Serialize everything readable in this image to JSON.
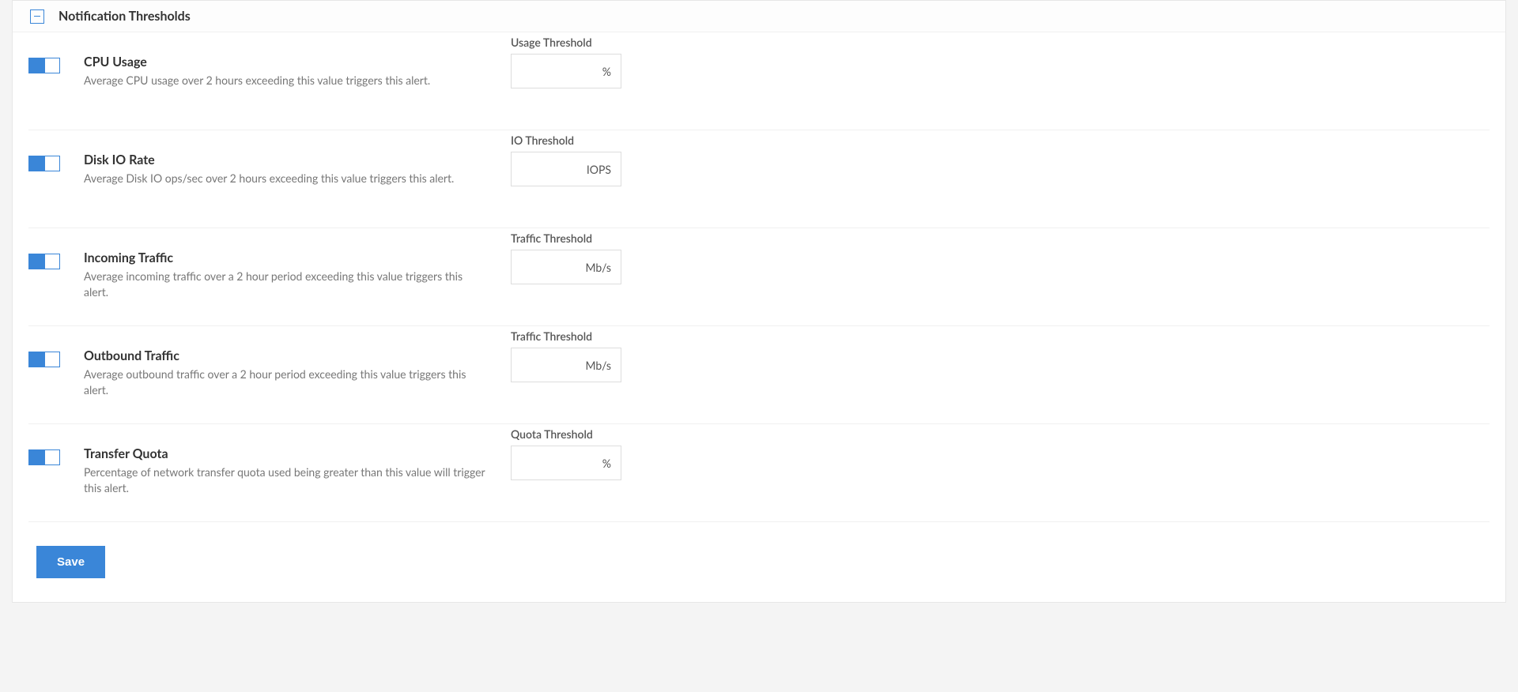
{
  "panel": {
    "title": "Notification Thresholds"
  },
  "rows": [
    {
      "title": "CPU Usage",
      "desc": "Average CPU usage over 2 hours exceeding this value triggers this alert.",
      "inputLabel": "Usage Threshold",
      "unit": "%",
      "value": ""
    },
    {
      "title": "Disk IO Rate",
      "desc": "Average Disk IO ops/sec over 2 hours exceeding this value triggers this alert.",
      "inputLabel": "IO Threshold",
      "unit": "IOPS",
      "value": ""
    },
    {
      "title": "Incoming Traffic",
      "desc": "Average incoming traffic over a 2 hour period exceeding this value triggers this alert.",
      "inputLabel": "Traffic Threshold",
      "unit": "Mb/s",
      "value": ""
    },
    {
      "title": "Outbound Traffic",
      "desc": "Average outbound traffic over a 2 hour period exceeding this value triggers this alert.",
      "inputLabel": "Traffic Threshold",
      "unit": "Mb/s",
      "value": ""
    },
    {
      "title": "Transfer Quota",
      "desc": "Percentage of network transfer quota used being greater than this value will trigger this alert.",
      "inputLabel": "Quota Threshold",
      "unit": "%",
      "value": ""
    }
  ],
  "actions": {
    "save": "Save"
  }
}
